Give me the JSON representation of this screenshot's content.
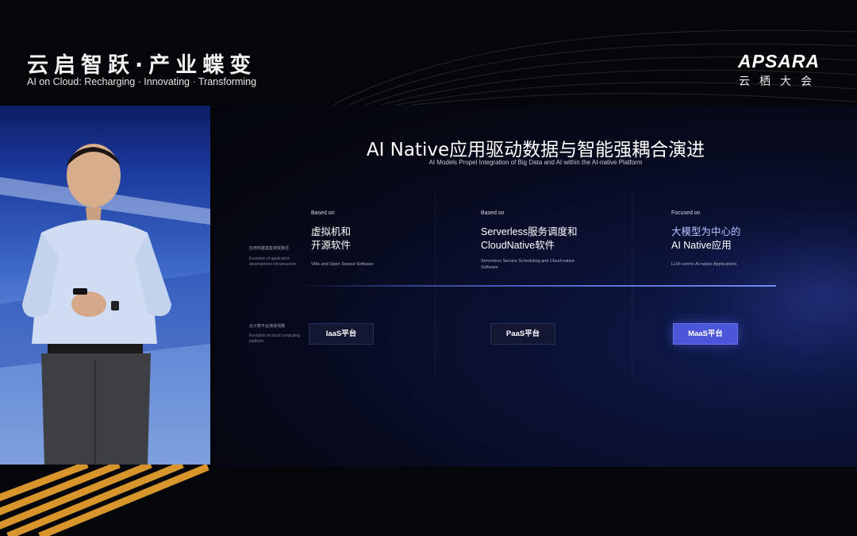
{
  "event": {
    "title": "云启智跃·产业蝶变",
    "subtitle": "AI on Cloud: Recharging · Innovating · Transforming"
  },
  "brand": {
    "logo": "APSARA",
    "tagline": "云栖大会"
  },
  "slide": {
    "title": "AI Native应用驱动数据与智能强耦合演进",
    "subtitle": "AI Models Propel Integration of Big Data and AI within the AI-native Platform",
    "row1": {
      "label_cn": "应用构建基座演变路径",
      "label_en": "Evolution of application development infrastructure"
    },
    "row2": {
      "label_cn": "云计算平台演进线路",
      "label_en": "Evolution of cloud computing platform"
    },
    "columns": [
      {
        "tag": "Based on",
        "heading_line1": "虚拟机和",
        "heading_line2": "开源软件",
        "desc": "VMs and Open Source Software",
        "badge": "IaaS平台"
      },
      {
        "tag": "Based on",
        "heading_line1": "Serverless服务调度和",
        "heading_line2": "CloudNative软件",
        "desc": "Serverless Service Scheduling and Cloud-native Software",
        "badge": "PaaS平台"
      },
      {
        "tag": "Focused on",
        "heading_line1": "大模型为中心的",
        "heading_line2": "AI Native应用",
        "desc": "LLM-centric AI-native Applications",
        "badge": "MaaS平台"
      }
    ]
  },
  "colors": {
    "accent": "#4c56d8",
    "highlight_text": "#b7c1ff",
    "stage_stripes": "#f0a530"
  }
}
